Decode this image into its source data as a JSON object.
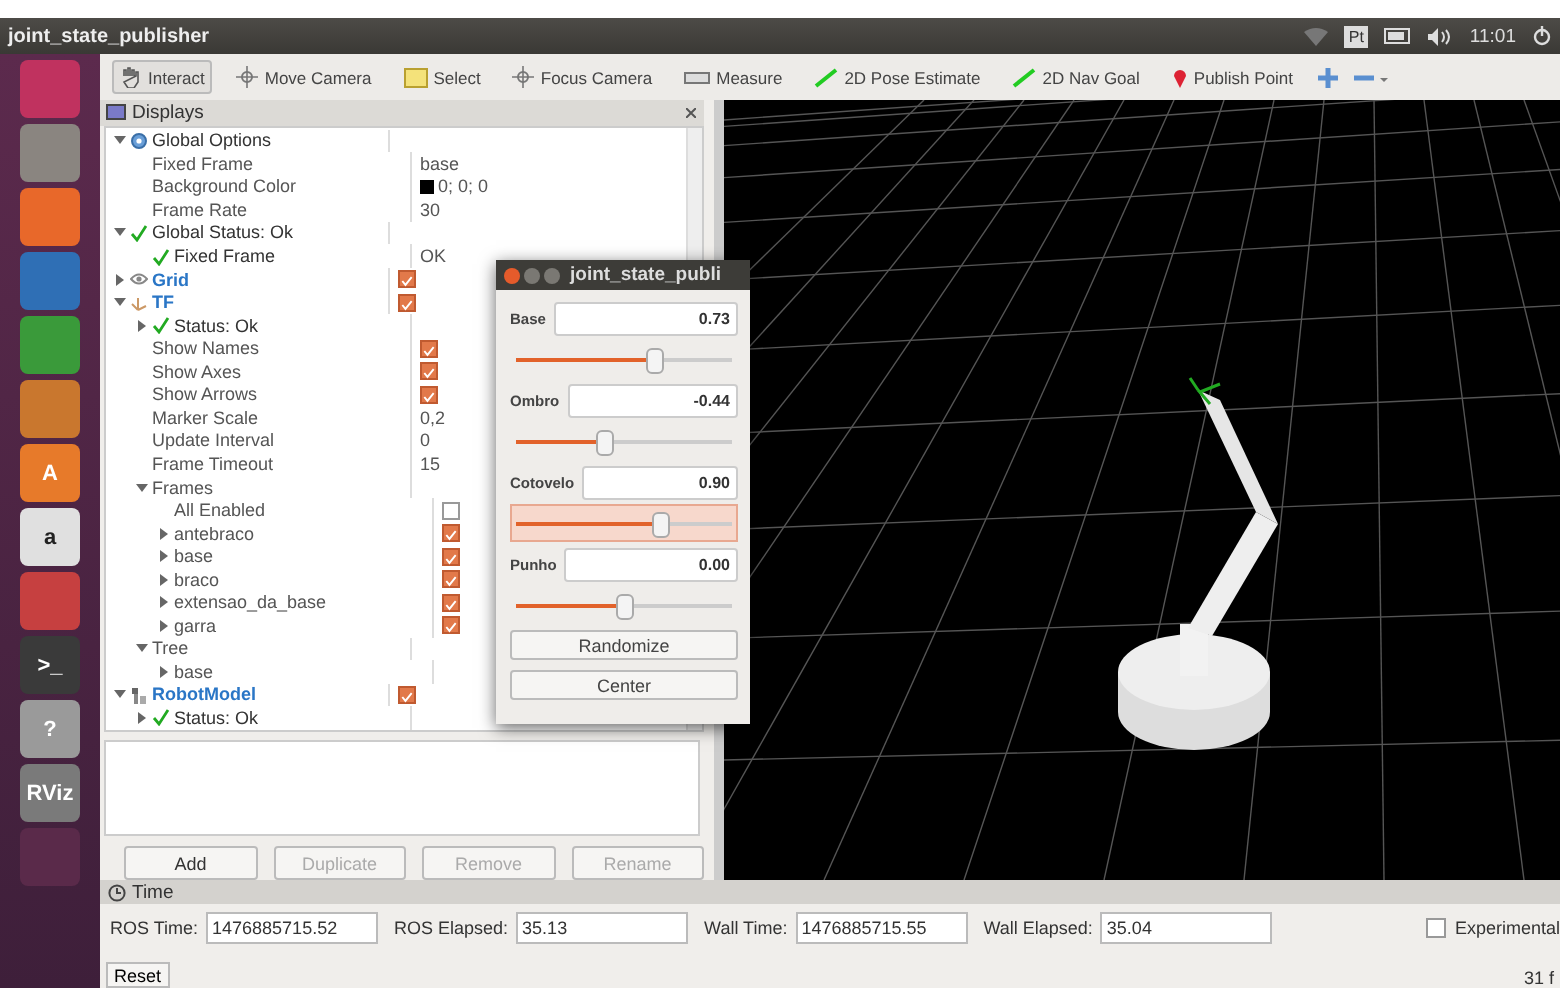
{
  "topbar": {
    "title": "joint_state_publisher",
    "keyboard": "Pt",
    "clock": "11:01"
  },
  "launcher": [
    {
      "color": "#c0325f"
    },
    {
      "color": "#8a8580"
    },
    {
      "color": "#e8682a"
    },
    {
      "color": "#2f6fb5"
    },
    {
      "color": "#3a9a3a"
    },
    {
      "color": "#c9772e"
    },
    {
      "color": "#e77a2a",
      "label": "A"
    },
    {
      "color": "#e0e0e0",
      "label": "a"
    },
    {
      "color": "#c64040"
    },
    {
      "color": "#3a3a3a",
      "label": ">_"
    },
    {
      "color": "#9a9a9a",
      "label": "?"
    },
    {
      "color": "#7a7a7a",
      "label": "RViz"
    },
    {
      "color": "#5a2a4a"
    }
  ],
  "toolbar": {
    "tools": [
      {
        "kind": "interact",
        "label": "Interact",
        "selected": true
      },
      {
        "kind": "move",
        "label": "Move Camera",
        "selected": false
      },
      {
        "kind": "select",
        "label": "Select",
        "selected": false
      },
      {
        "kind": "focus",
        "label": "Focus Camera",
        "selected": false
      },
      {
        "kind": "measure",
        "label": "Measure",
        "selected": false
      },
      {
        "kind": "pose",
        "label": "2D Pose Estimate",
        "selected": false
      },
      {
        "kind": "goal",
        "label": "2D Nav Goal",
        "selected": false
      },
      {
        "kind": "point",
        "label": "Publish Point",
        "selected": false
      }
    ]
  },
  "displays": {
    "title": "Displays",
    "tree": [
      {
        "kind": "options",
        "label": "Global Options",
        "expanded": true,
        "children": [
          {
            "kind": "property",
            "label": "Fixed Frame",
            "value": "base"
          },
          {
            "kind": "color",
            "label": "Background Color",
            "value": "0; 0; 0"
          },
          {
            "kind": "property",
            "label": "Frame Rate",
            "value": "30"
          }
        ]
      },
      {
        "kind": "status",
        "label": "Global Status: Ok",
        "expanded": true,
        "children": [
          {
            "kind": "status",
            "label": "Fixed Frame",
            "value": "OK"
          }
        ]
      },
      {
        "kind": "grid",
        "label": "Grid",
        "expanded": false,
        "checked": true
      },
      {
        "kind": "tf",
        "label": "TF",
        "expanded": true,
        "checked": true,
        "children": [
          {
            "kind": "status",
            "label": "Status: Ok",
            "expanded": false
          },
          {
            "kind": "property",
            "label": "Show Names",
            "checked": true
          },
          {
            "kind": "property",
            "label": "Show Axes",
            "checked": true
          },
          {
            "kind": "property",
            "label": "Show Arrows",
            "checked": true
          },
          {
            "kind": "property",
            "label": "Marker Scale",
            "value": "0,2"
          },
          {
            "kind": "property",
            "label": "Update Interval",
            "value": "0"
          },
          {
            "kind": "property",
            "label": "Frame Timeout",
            "value": "15"
          },
          {
            "kind": "property",
            "label": "Frames",
            "expanded": true,
            "children": [
              {
                "kind": "property",
                "label": "All Enabled",
                "checked": false
              },
              {
                "kind": "property",
                "label": "antebraco",
                "expanded": false,
                "checked": true
              },
              {
                "kind": "property",
                "label": "base",
                "expanded": false,
                "checked": true
              },
              {
                "kind": "property",
                "label": "braco",
                "expanded": false,
                "checked": true
              },
              {
                "kind": "property",
                "label": "extensao_da_base",
                "expanded": false,
                "checked": true
              },
              {
                "kind": "property",
                "label": "garra",
                "expanded": false,
                "checked": true
              }
            ]
          },
          {
            "kind": "property",
            "label": "Tree",
            "expanded": true,
            "children": [
              {
                "kind": "property",
                "label": "base",
                "expanded": false
              }
            ]
          }
        ]
      },
      {
        "kind": "robot",
        "label": "RobotModel",
        "expanded": true,
        "checked": true,
        "children": [
          {
            "kind": "status",
            "label": "Status: Ok",
            "expanded": false
          }
        ]
      }
    ],
    "buttons": [
      {
        "label": "Add",
        "disabled": false
      },
      {
        "label": "Duplicate",
        "disabled": true
      },
      {
        "label": "Remove",
        "disabled": true
      },
      {
        "label": "Rename",
        "disabled": true
      }
    ]
  },
  "dialog": {
    "title": "joint_state_publi",
    "joints": [
      {
        "name": "Base",
        "value": "0.73",
        "level": 0.64,
        "focused": false
      },
      {
        "name": "Ombro",
        "value": "-0.44",
        "level": 0.41,
        "focused": false
      },
      {
        "name": "Cotovelo",
        "value": "0.90",
        "level": 0.67,
        "focused": true
      },
      {
        "name": "Punho",
        "value": "0.00",
        "level": 0.5,
        "focused": false
      }
    ],
    "buttons": [
      "Randomize",
      "Center"
    ]
  },
  "time": {
    "title": "Time",
    "fields": [
      {
        "label": "ROS Time:",
        "value": "1476885715.52"
      },
      {
        "label": "ROS Elapsed:",
        "value": "35.13"
      },
      {
        "label": "Wall Time:",
        "value": "1476885715.55"
      },
      {
        "label": "Wall Elapsed:",
        "value": "35.04"
      }
    ],
    "experimental": {
      "label": "Experimental",
      "checked": false
    }
  },
  "status_bar": {
    "reset": "Reset",
    "fps": "31 f"
  }
}
